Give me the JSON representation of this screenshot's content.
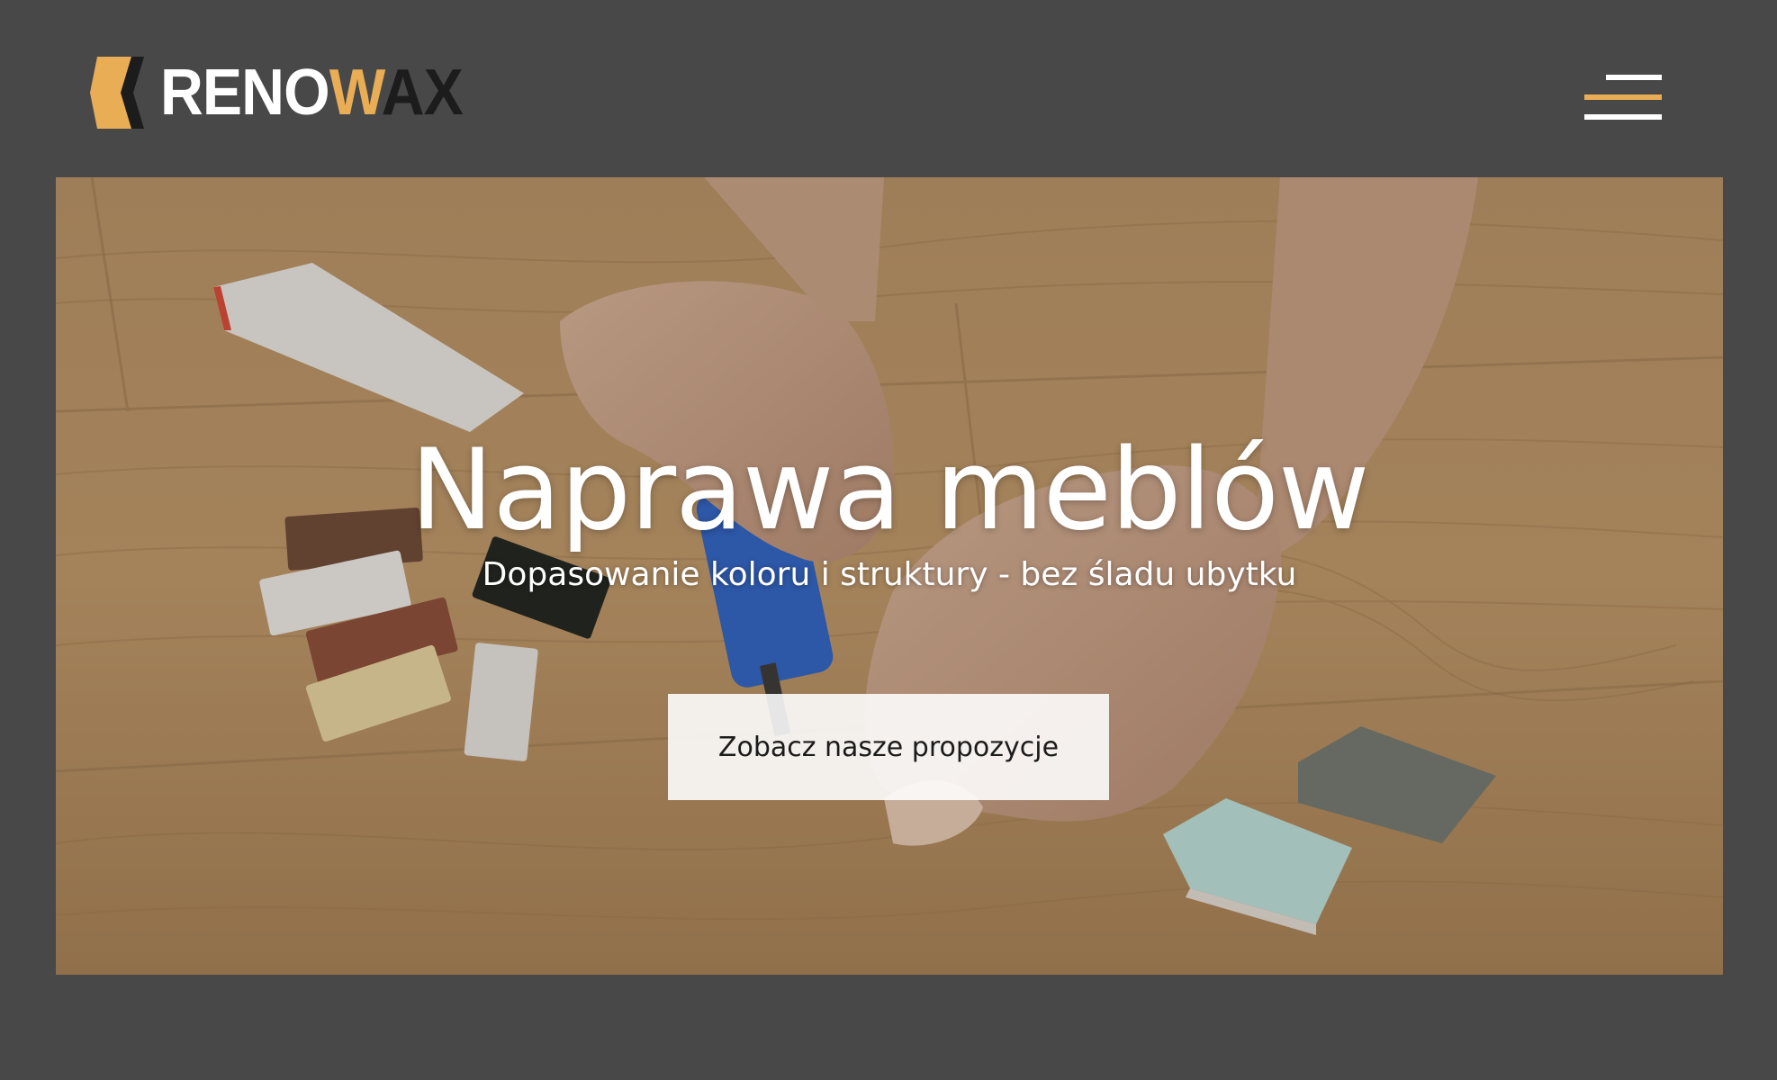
{
  "header": {
    "logo": {
      "text_main": "RENO",
      "text_accent": "W",
      "text_end": "AX",
      "icon": "renowax-logo-icon"
    },
    "menu_icon": "hamburger-menu-icon"
  },
  "hero": {
    "title": "Naprawa meblów",
    "subtitle": "Dopasowanie koloru i struktury - bez śladu ubytku",
    "cta_label": "Zobacz nasze propozycje"
  },
  "colors": {
    "page_background": "#484849",
    "accent": "#e9ad56",
    "logo_dark": "#1c1c1c",
    "text_light": "#ffffff"
  }
}
